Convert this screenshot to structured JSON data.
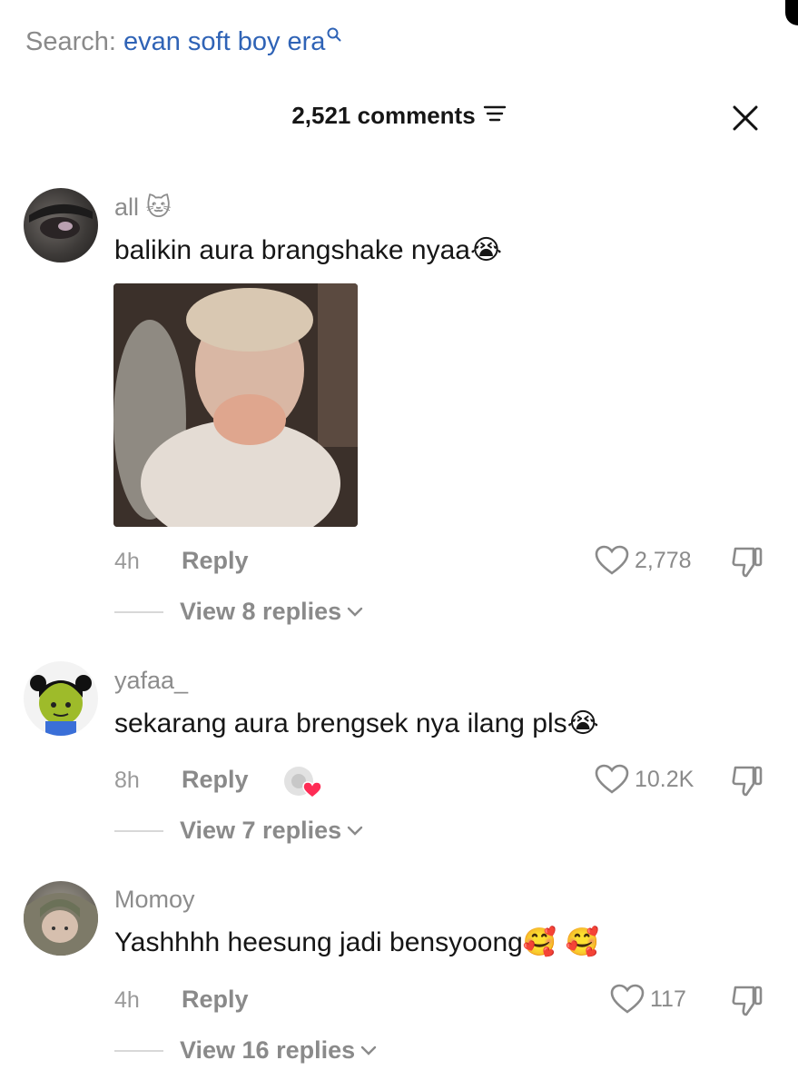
{
  "search": {
    "label": "Search:",
    "query": "evan soft boy era"
  },
  "header": {
    "count": "2,521 comments"
  },
  "comments": [
    {
      "username": "all",
      "username_emoji": "🐱",
      "text": "balikin aura brangshake nyaa",
      "text_emoji": "😭",
      "time": "4h",
      "reply": "Reply",
      "likes": "2,778",
      "view_replies": "View 8 replies"
    },
    {
      "username": "yafaa_",
      "text": "sekarang aura brengsek nya ilang pls",
      "text_emoji": "😭",
      "time": "8h",
      "reply": "Reply",
      "likes": "10.2K",
      "view_replies": "View 7 replies"
    },
    {
      "username": "Momoy",
      "text": "Yashhhh heesung jadi bensyoong",
      "text_emoji": "🥰 🥰",
      "time": "4h",
      "reply": "Reply",
      "likes": "117",
      "view_replies": "View 16 replies"
    }
  ],
  "colors": {
    "search_query": "#2f63b6",
    "muted": "#8a8a8a",
    "heart_badge": "#fe2c55"
  }
}
